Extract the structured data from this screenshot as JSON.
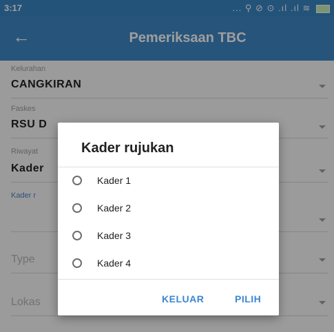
{
  "status_bar": {
    "time": "3:17",
    "indicators": "... ⚲ ⊘ ⊙ .ıl .ıl ≋"
  },
  "app_bar": {
    "title": "Pemeriksaan TBC"
  },
  "form": {
    "kelurahan": {
      "label": "Kelurahan",
      "value": "CANGKIRAN"
    },
    "faskes": {
      "label": "Faskes",
      "value": "RSU D"
    },
    "riwayat": {
      "label": "Riwayat",
      "value": "Kader"
    },
    "kader": {
      "label": "Kader r"
    },
    "type": {
      "placeholder": "Type"
    },
    "lokasi": {
      "placeholder": "Lokas"
    }
  },
  "dialog": {
    "title": "Kader rujukan",
    "options": [
      "Kader 1",
      "Kader 2",
      "Kader 3",
      "Kader 4"
    ],
    "cancel_label": "KELUAR",
    "confirm_label": "PILIH"
  },
  "colors": {
    "primary": "#3f88c7",
    "accent": "#3b86d0"
  }
}
